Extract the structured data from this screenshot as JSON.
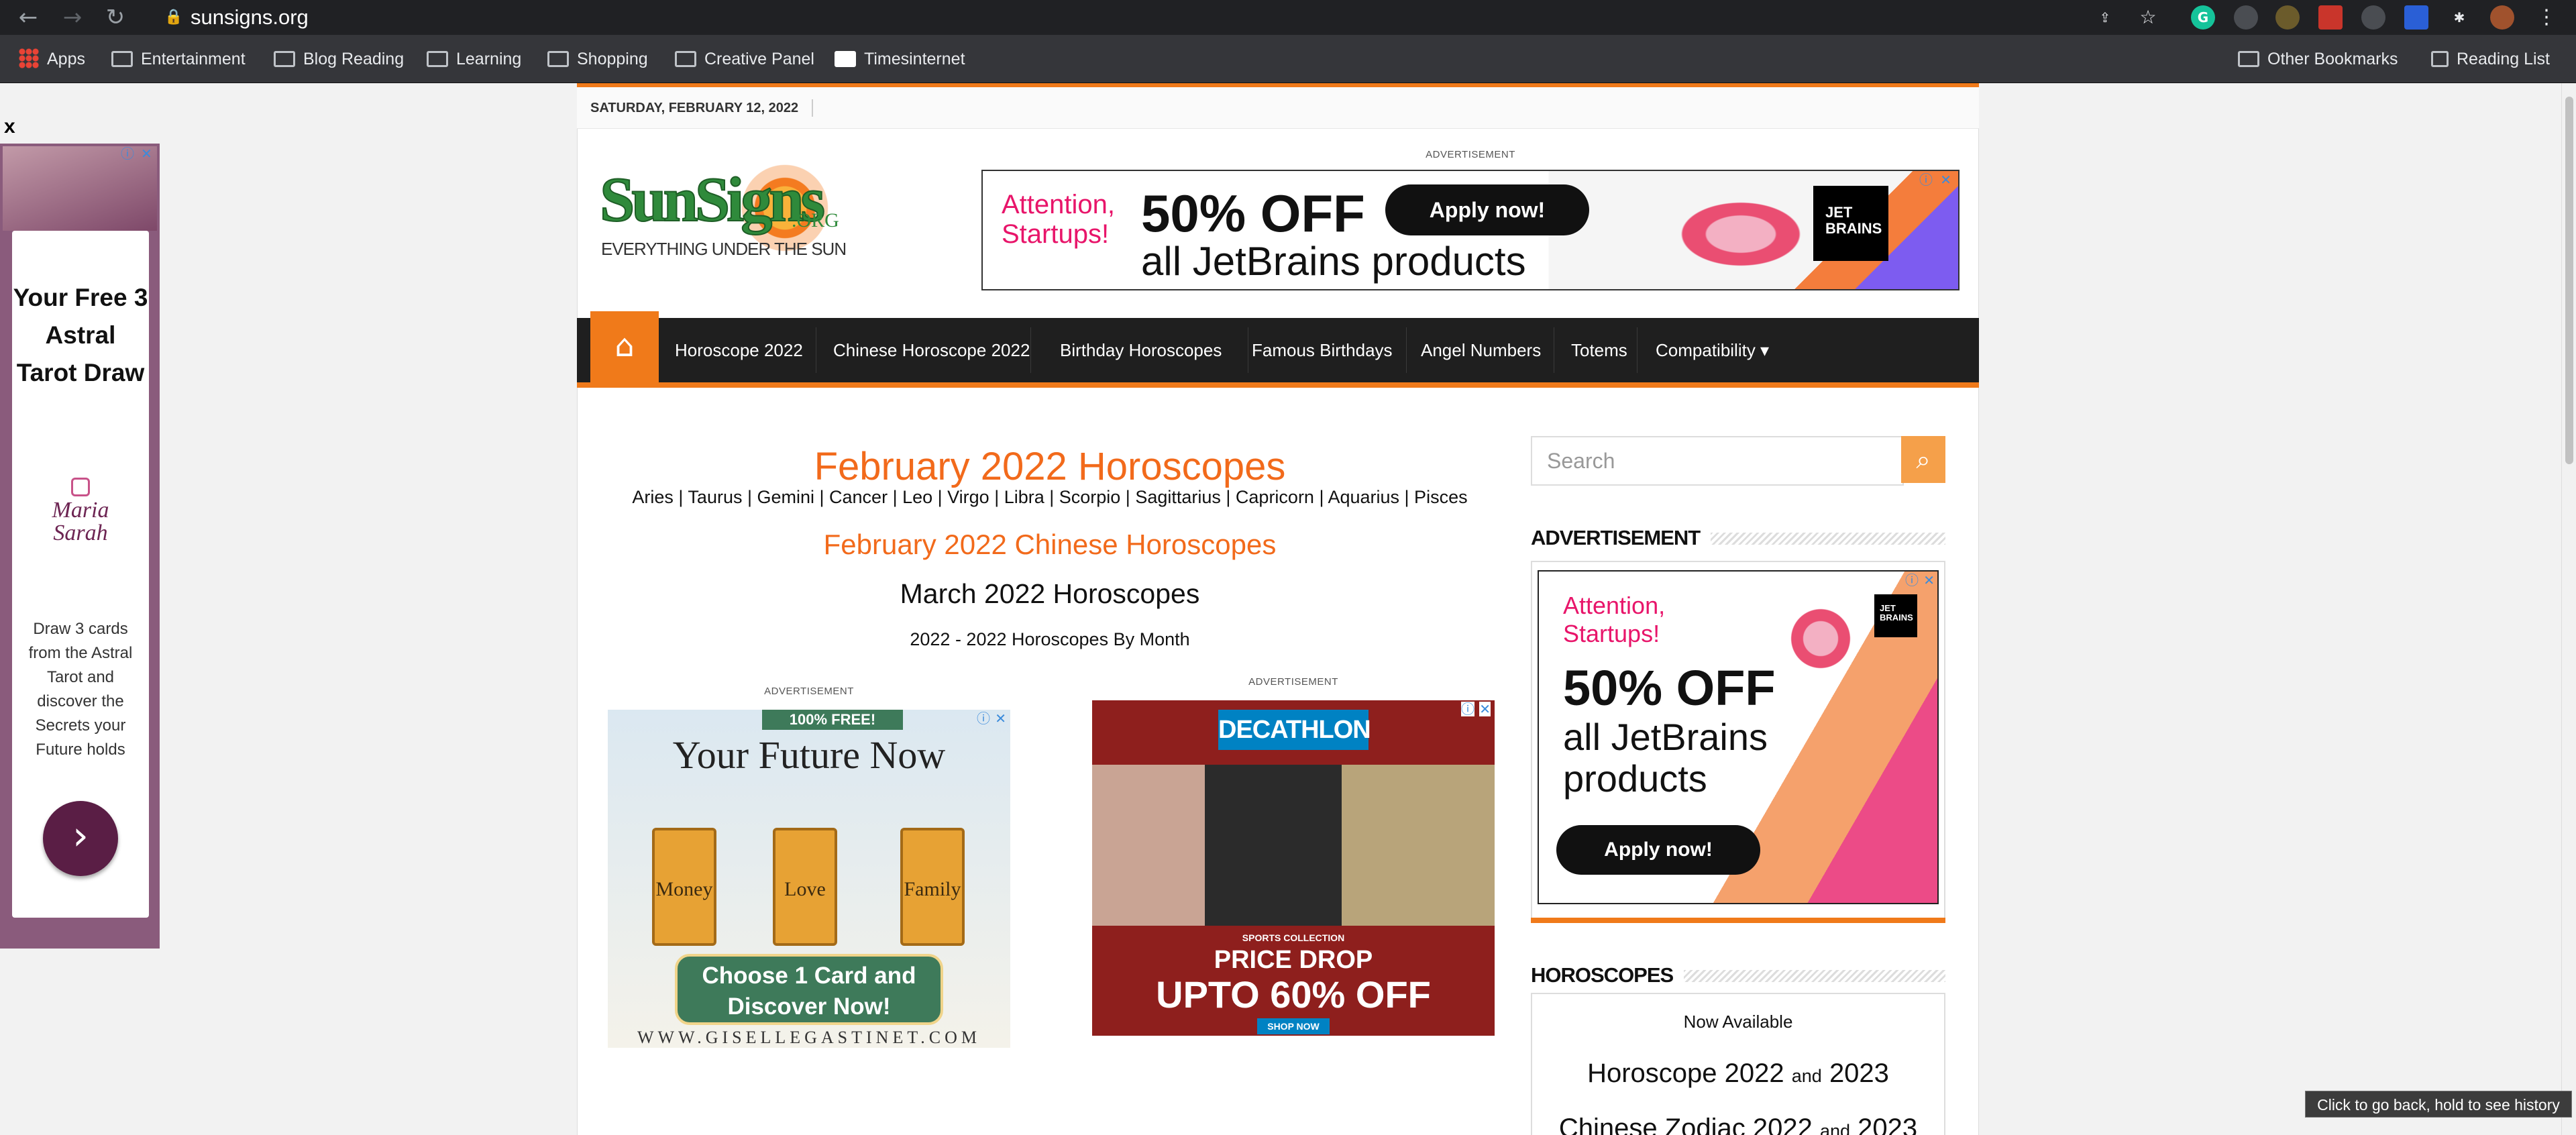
{
  "browser": {
    "url": "sunsigns.org",
    "back_icon": "←",
    "forward_icon": "→",
    "reload_icon": "↻",
    "lock_icon": "🔒",
    "share_icon": "⇪",
    "star_icon": "☆",
    "ext_grammarly": "G",
    "ext_puzzle_icon": "✱",
    "menu_icon": "⋮",
    "bookmarks": [
      {
        "label": "Apps"
      },
      {
        "label": "Entertainment"
      },
      {
        "label": "Blog Reading"
      },
      {
        "label": "Learning"
      },
      {
        "label": "Shopping"
      },
      {
        "label": "Creative Panel"
      },
      {
        "label": "Timesinternet"
      }
    ],
    "other_bookmarks": "Other Bookmarks",
    "reading_list": "Reading List",
    "back_tooltip": "Click to go back, hold to see history"
  },
  "site": {
    "date": "SATURDAY, FEBRUARY 12, 2022",
    "logo": {
      "text": "SunSigns",
      "org": ".ORG",
      "tagline": "EVERYTHING UNDER THE SUN"
    },
    "advertisement_label": "ADVERTISEMENT",
    "top_banner": {
      "headline": "Attention, Startups!",
      "offer": "50% OFF",
      "cta": "Apply now!",
      "line2": "all JetBrains products",
      "brand": "JET BRAINS"
    },
    "nav": {
      "home_icon": "⌂",
      "items": [
        {
          "label": "Horoscope 2022"
        },
        {
          "label": "Chinese Horoscope 2022"
        },
        {
          "label": "Birthday Horoscopes"
        },
        {
          "label": "Famous Birthdays"
        },
        {
          "label": "Angel Numbers"
        },
        {
          "label": "Totems"
        },
        {
          "label": "Compatibility ▾"
        }
      ]
    },
    "main": {
      "title": "February 2022 Horoscopes",
      "signs": "Aries | Taurus | Gemini | Cancer | Leo | Virgo | Libra | Scorpio | Sagittarius | Capricorn | Aquarius | Pisces",
      "chinese_link": "February 2022 Chinese Horoscopes",
      "march_link": "March 2022 Horoscopes",
      "by_month_link": "2022 - 2022 Horoscopes By Month"
    },
    "ad_tarot": {
      "badge": "100% FREE!",
      "headline": "Your Future Now",
      "cards": [
        "Money",
        "Love",
        "Family"
      ],
      "cta": "Choose 1 Card and Discover Now!",
      "url": "WWW.GISELLEGASTINET.COM"
    },
    "ad_decathlon": {
      "brand": "DECATHLON",
      "sub": "SPORTS COLLECTION",
      "headline": "PRICE DROP",
      "discount": "UPTO 60% OFF",
      "cta": "SHOP NOW"
    },
    "sidebar": {
      "search_placeholder": "Search",
      "search_icon": "⌕",
      "ad_heading": "ADVERTISEMENT",
      "side_ad": {
        "headline": "Attention, Startups!",
        "offer": "50% OFF",
        "line2": "all JetBrains products",
        "cta": "Apply now!",
        "brand": "JET BRAINS"
      },
      "horoscopes_heading": "HOROSCOPES",
      "now_available": "Now Available",
      "horoscope_years": "Horoscope 2022",
      "and": "and",
      "horoscope_year2": "2023",
      "chinese_zodiac": "Chinese Zodiac 2022",
      "chinese_year2": "2023"
    },
    "left_ad": {
      "close": "x",
      "headline": "Your Free 3 Astral Tarot Draw",
      "brand": "Maria Sarah",
      "body": "Draw 3 cards from the Astral Tarot and discover the Secrets your Future holds",
      "next_icon": "›"
    }
  }
}
